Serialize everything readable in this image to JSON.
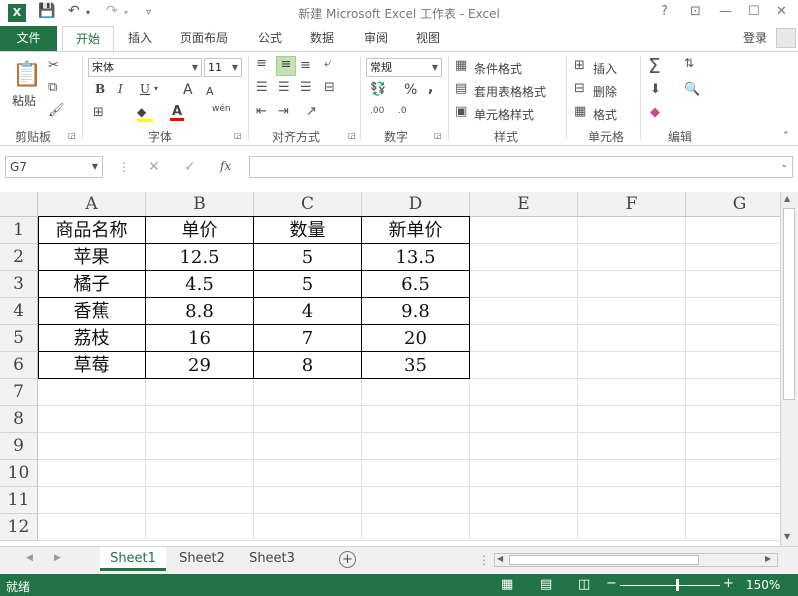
{
  "window": {
    "title": "新建 Microsoft Excel 工作表 - Excel",
    "help": "?",
    "restore": "⊡",
    "minimize": "—",
    "maximize": "☐",
    "close": "✕"
  },
  "tabs": {
    "file": "文件",
    "items": [
      "开始",
      "插入",
      "页面布局",
      "公式",
      "数据",
      "审阅",
      "视图"
    ],
    "login": "登录"
  },
  "ribbon": {
    "clipboard": {
      "paste": "粘贴",
      "label": "剪贴板"
    },
    "font": {
      "name": "宋体",
      "size": "11",
      "bold": "B",
      "italic": "I",
      "underline": "U",
      "grow": "A",
      "shrink": "A",
      "wen": "wén",
      "label": "字体"
    },
    "align": {
      "label": "对齐方式"
    },
    "number": {
      "format": "常规",
      "percent": "%",
      "comma": ",",
      "label": "数字"
    },
    "styles": {
      "cond": "条件格式",
      "table": "套用表格格式",
      "cell": "单元格样式",
      "label": "样式"
    },
    "cells": {
      "insert": "插入",
      "delete": "删除",
      "format": "格式",
      "label": "单元格"
    },
    "editing": {
      "label": "编辑"
    }
  },
  "formula_bar": {
    "name_box": "G7",
    "fx": "fx",
    "value": ""
  },
  "columns": [
    "A",
    "B",
    "C",
    "D",
    "E",
    "F",
    "G"
  ],
  "rows": [
    "1",
    "2",
    "3",
    "4",
    "5",
    "6",
    "7",
    "8",
    "9",
    "10",
    "11",
    "12"
  ],
  "table": [
    [
      "商品名称",
      "单价",
      "数量",
      "新单价"
    ],
    [
      "苹果",
      "12.5",
      "5",
      "13.5"
    ],
    [
      "橘子",
      "4.5",
      "5",
      "6.5"
    ],
    [
      "香蕉",
      "8.8",
      "4",
      "9.8"
    ],
    [
      "荔枝",
      "16",
      "7",
      "20"
    ],
    [
      "草莓",
      "29",
      "8",
      "35"
    ]
  ],
  "sheets": [
    "Sheet1",
    "Sheet2",
    "Sheet3"
  ],
  "status": {
    "ready": "就绪",
    "zoom": "150%"
  },
  "colors": {
    "accent": "#217346"
  }
}
